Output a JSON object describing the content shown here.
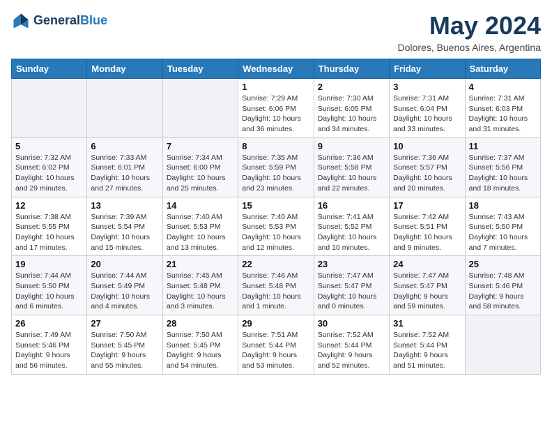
{
  "logo": {
    "line1": "General",
    "line2": "Blue"
  },
  "title": "May 2024",
  "location": "Dolores, Buenos Aires, Argentina",
  "days_of_week": [
    "Sunday",
    "Monday",
    "Tuesday",
    "Wednesday",
    "Thursday",
    "Friday",
    "Saturday"
  ],
  "weeks": [
    [
      {
        "day": "",
        "info": ""
      },
      {
        "day": "",
        "info": ""
      },
      {
        "day": "",
        "info": ""
      },
      {
        "day": "1",
        "info": "Sunrise: 7:29 AM\nSunset: 6:06 PM\nDaylight: 10 hours\nand 36 minutes."
      },
      {
        "day": "2",
        "info": "Sunrise: 7:30 AM\nSunset: 6:05 PM\nDaylight: 10 hours\nand 34 minutes."
      },
      {
        "day": "3",
        "info": "Sunrise: 7:31 AM\nSunset: 6:04 PM\nDaylight: 10 hours\nand 33 minutes."
      },
      {
        "day": "4",
        "info": "Sunrise: 7:31 AM\nSunset: 6:03 PM\nDaylight: 10 hours\nand 31 minutes."
      }
    ],
    [
      {
        "day": "5",
        "info": "Sunrise: 7:32 AM\nSunset: 6:02 PM\nDaylight: 10 hours\nand 29 minutes."
      },
      {
        "day": "6",
        "info": "Sunrise: 7:33 AM\nSunset: 6:01 PM\nDaylight: 10 hours\nand 27 minutes."
      },
      {
        "day": "7",
        "info": "Sunrise: 7:34 AM\nSunset: 6:00 PM\nDaylight: 10 hours\nand 25 minutes."
      },
      {
        "day": "8",
        "info": "Sunrise: 7:35 AM\nSunset: 5:59 PM\nDaylight: 10 hours\nand 23 minutes."
      },
      {
        "day": "9",
        "info": "Sunrise: 7:36 AM\nSunset: 5:58 PM\nDaylight: 10 hours\nand 22 minutes."
      },
      {
        "day": "10",
        "info": "Sunrise: 7:36 AM\nSunset: 5:57 PM\nDaylight: 10 hours\nand 20 minutes."
      },
      {
        "day": "11",
        "info": "Sunrise: 7:37 AM\nSunset: 5:56 PM\nDaylight: 10 hours\nand 18 minutes."
      }
    ],
    [
      {
        "day": "12",
        "info": "Sunrise: 7:38 AM\nSunset: 5:55 PM\nDaylight: 10 hours\nand 17 minutes."
      },
      {
        "day": "13",
        "info": "Sunrise: 7:39 AM\nSunset: 5:54 PM\nDaylight: 10 hours\nand 15 minutes."
      },
      {
        "day": "14",
        "info": "Sunrise: 7:40 AM\nSunset: 5:53 PM\nDaylight: 10 hours\nand 13 minutes."
      },
      {
        "day": "15",
        "info": "Sunrise: 7:40 AM\nSunset: 5:53 PM\nDaylight: 10 hours\nand 12 minutes."
      },
      {
        "day": "16",
        "info": "Sunrise: 7:41 AM\nSunset: 5:52 PM\nDaylight: 10 hours\nand 10 minutes."
      },
      {
        "day": "17",
        "info": "Sunrise: 7:42 AM\nSunset: 5:51 PM\nDaylight: 10 hours\nand 9 minutes."
      },
      {
        "day": "18",
        "info": "Sunrise: 7:43 AM\nSunset: 5:50 PM\nDaylight: 10 hours\nand 7 minutes."
      }
    ],
    [
      {
        "day": "19",
        "info": "Sunrise: 7:44 AM\nSunset: 5:50 PM\nDaylight: 10 hours\nand 6 minutes."
      },
      {
        "day": "20",
        "info": "Sunrise: 7:44 AM\nSunset: 5:49 PM\nDaylight: 10 hours\nand 4 minutes."
      },
      {
        "day": "21",
        "info": "Sunrise: 7:45 AM\nSunset: 5:48 PM\nDaylight: 10 hours\nand 3 minutes."
      },
      {
        "day": "22",
        "info": "Sunrise: 7:46 AM\nSunset: 5:48 PM\nDaylight: 10 hours\nand 1 minute."
      },
      {
        "day": "23",
        "info": "Sunrise: 7:47 AM\nSunset: 5:47 PM\nDaylight: 10 hours\nand 0 minutes."
      },
      {
        "day": "24",
        "info": "Sunrise: 7:47 AM\nSunset: 5:47 PM\nDaylight: 9 hours\nand 59 minutes."
      },
      {
        "day": "25",
        "info": "Sunrise: 7:48 AM\nSunset: 5:46 PM\nDaylight: 9 hours\nand 58 minutes."
      }
    ],
    [
      {
        "day": "26",
        "info": "Sunrise: 7:49 AM\nSunset: 5:46 PM\nDaylight: 9 hours\nand 56 minutes."
      },
      {
        "day": "27",
        "info": "Sunrise: 7:50 AM\nSunset: 5:45 PM\nDaylight: 9 hours\nand 55 minutes."
      },
      {
        "day": "28",
        "info": "Sunrise: 7:50 AM\nSunset: 5:45 PM\nDaylight: 9 hours\nand 54 minutes."
      },
      {
        "day": "29",
        "info": "Sunrise: 7:51 AM\nSunset: 5:44 PM\nDaylight: 9 hours\nand 53 minutes."
      },
      {
        "day": "30",
        "info": "Sunrise: 7:52 AM\nSunset: 5:44 PM\nDaylight: 9 hours\nand 52 minutes."
      },
      {
        "day": "31",
        "info": "Sunrise: 7:52 AM\nSunset: 5:44 PM\nDaylight: 9 hours\nand 51 minutes."
      },
      {
        "day": "",
        "info": ""
      }
    ]
  ]
}
